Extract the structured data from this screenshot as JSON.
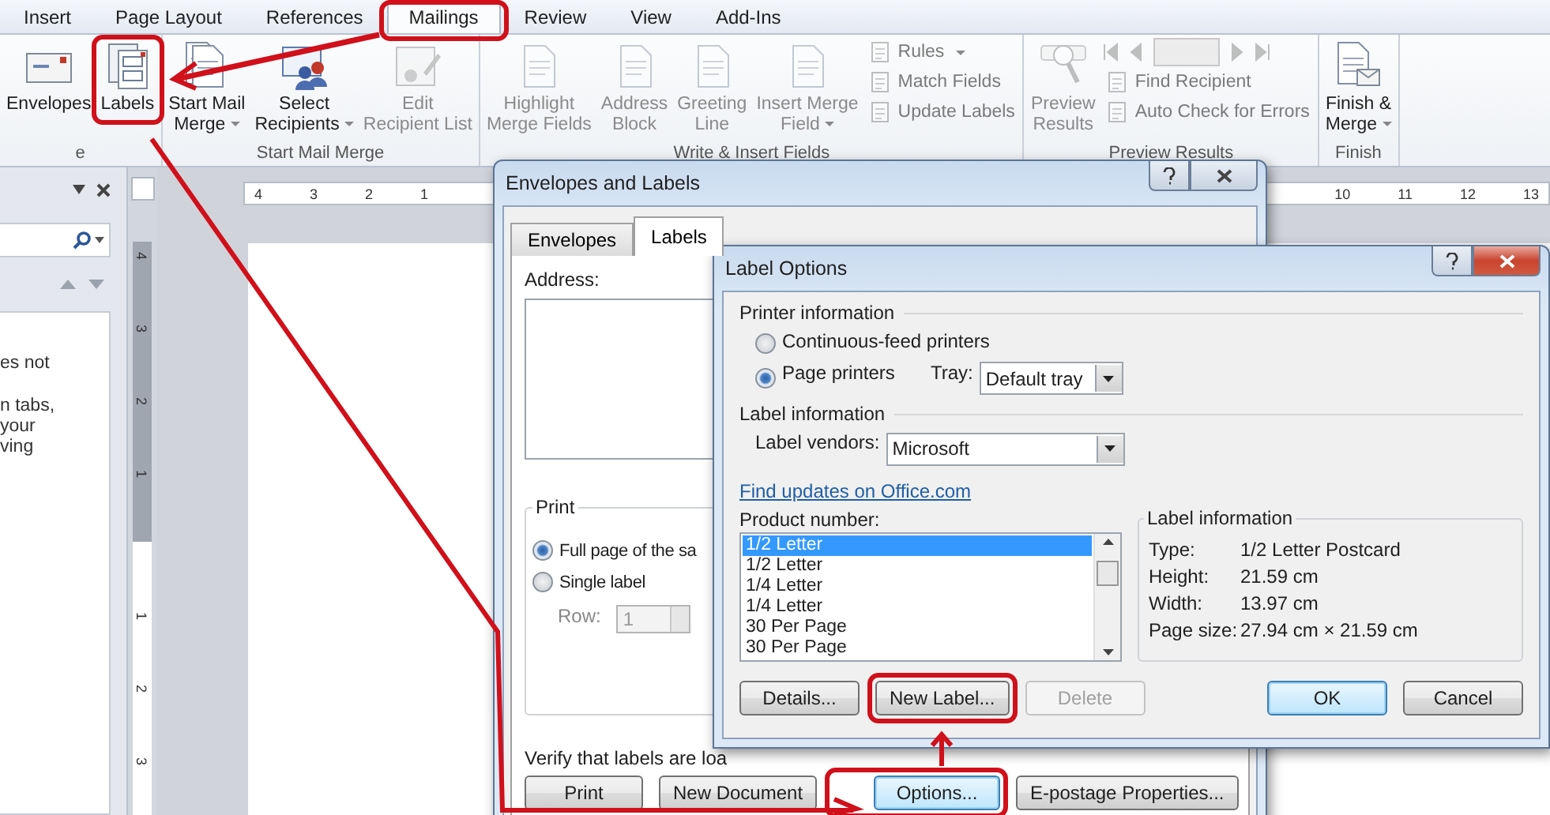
{
  "ribbon_tabs": [
    {
      "label": "Insert",
      "selected": false,
      "annotated": false
    },
    {
      "label": "Page Layout",
      "selected": false,
      "annotated": false
    },
    {
      "label": "References",
      "selected": false,
      "annotated": false
    },
    {
      "label": "Mailings",
      "selected": true,
      "annotated": true
    },
    {
      "label": "Review",
      "selected": false,
      "annotated": false
    },
    {
      "label": "View",
      "selected": false,
      "annotated": false
    },
    {
      "label": "Add-Ins",
      "selected": false,
      "annotated": false
    }
  ],
  "ribbon_groups": [
    {
      "label": "e",
      "large_buttons": [
        {
          "lines": [
            "Envelopes"
          ],
          "dropdown": false,
          "disabled": false,
          "annotated": false
        },
        {
          "lines": [
            "Labels"
          ],
          "dropdown": false,
          "disabled": false,
          "annotated": true
        }
      ]
    },
    {
      "label": "Start Mail Merge",
      "large_buttons": [
        {
          "lines": [
            "Start Mail",
            "Merge"
          ],
          "dropdown": true,
          "disabled": false,
          "annotated": false
        },
        {
          "lines": [
            "Select",
            "Recipients"
          ],
          "dropdown": true,
          "disabled": false,
          "annotated": false
        },
        {
          "lines": [
            "Edit",
            "Recipient List"
          ],
          "dropdown": false,
          "disabled": true,
          "annotated": false
        }
      ]
    },
    {
      "label": "Write & Insert Fields",
      "large_buttons": [
        {
          "lines": [
            "Highlight",
            "Merge Fields"
          ],
          "dropdown": false,
          "disabled": true,
          "annotated": false
        },
        {
          "lines": [
            "Address",
            "Block"
          ],
          "dropdown": false,
          "disabled": true,
          "annotated": false
        },
        {
          "lines": [
            "Greeting",
            "Line"
          ],
          "dropdown": false,
          "disabled": true,
          "annotated": false
        },
        {
          "lines": [
            "Insert Merge",
            "Field"
          ],
          "dropdown": true,
          "disabled": true,
          "annotated": false
        }
      ],
      "small_buttons": [
        {
          "label": "Rules",
          "dropdown": true,
          "disabled": true
        },
        {
          "label": "Match Fields",
          "dropdown": false,
          "disabled": true
        },
        {
          "label": "Update Labels",
          "dropdown": false,
          "disabled": true
        }
      ]
    },
    {
      "label": "Preview Results",
      "large_buttons": [
        {
          "lines": [
            "Preview",
            "Results"
          ],
          "dropdown": false,
          "disabled": true,
          "annotated": false
        }
      ],
      "record_navigator": {
        "disabled": true
      },
      "small_buttons": [
        {
          "label": "Find Recipient",
          "dropdown": false,
          "disabled": true
        },
        {
          "label": "Auto Check for Errors",
          "dropdown": false,
          "disabled": true
        }
      ]
    },
    {
      "label": "Finish",
      "large_buttons": [
        {
          "lines": [
            "Finish &",
            "Merge"
          ],
          "dropdown": true,
          "disabled": false,
          "annotated": false
        }
      ]
    }
  ],
  "nav_pane": {
    "paragraphs": [
      [
        "es not"
      ],
      [
        "n tabs,",
        "your",
        "ving"
      ]
    ]
  },
  "horizontal_ruler": {
    "left_numbers": [
      "4",
      "3",
      "2",
      "1"
    ],
    "right_numbers": [
      "10",
      "11",
      "12",
      "13"
    ]
  },
  "vertical_ruler": [
    "4",
    "3",
    "2",
    "1",
    "1",
    "2",
    "3"
  ],
  "envelopes_dialog": {
    "title": "Envelopes and Labels",
    "tabs": [
      {
        "label": "Envelopes",
        "selected": false
      },
      {
        "label": "Labels",
        "selected": true
      }
    ],
    "address_label": "Address:",
    "print_group": {
      "title": "Print",
      "options": [
        {
          "label": "Full page of the sa",
          "selected": true
        },
        {
          "label": "Single label",
          "selected": false
        }
      ],
      "row_label": "Row:",
      "row_value": "1",
      "row_disabled": true
    },
    "verify_text": "Verify that labels are loa",
    "buttons": [
      {
        "label": "Print",
        "focused": false,
        "annotated": false
      },
      {
        "label": "New Document",
        "focused": false,
        "annotated": false
      },
      {
        "label": "Options...",
        "focused": true,
        "annotated": true
      },
      {
        "label": "E-postage Properties...",
        "focused": false,
        "annotated": false
      }
    ]
  },
  "label_options": {
    "title": "Label Options",
    "printer_information": {
      "title": "Printer information",
      "options": [
        {
          "label": "Continuous-feed printers",
          "selected": false
        },
        {
          "label": "Page printers",
          "selected": true
        }
      ],
      "tray_label": "Tray:",
      "tray_value": "Default tray"
    },
    "label_information": {
      "title": "Label information",
      "vendors_label": "Label vendors:",
      "vendor_value": "Microsoft",
      "link": "Find updates on Office.com"
    },
    "product_number": {
      "label": "Product number:",
      "items": [
        {
          "label": "1/2 Letter",
          "selected": true
        },
        {
          "label": "1/2 Letter",
          "selected": false
        },
        {
          "label": "1/4 Letter",
          "selected": false
        },
        {
          "label": "1/4 Letter",
          "selected": false
        },
        {
          "label": "30 Per Page",
          "selected": false
        },
        {
          "label": "30 Per Page",
          "selected": false
        }
      ]
    },
    "details": {
      "title": "Label information",
      "rows": [
        {
          "name": "Type:",
          "value": "1/2 Letter Postcard"
        },
        {
          "name": "Height:",
          "value": "21.59 cm"
        },
        {
          "name": "Width:",
          "value": "13.97 cm"
        },
        {
          "name": "Page size:",
          "value": "27.94 cm × 21.59 cm"
        }
      ]
    },
    "buttons_left": [
      {
        "label": "Details...",
        "disabled": false,
        "default": false,
        "annotated": false
      },
      {
        "label": "New Label...",
        "disabled": false,
        "default": false,
        "annotated": true
      },
      {
        "label": "Delete",
        "disabled": true,
        "default": false,
        "annotated": false
      }
    ],
    "buttons_right": [
      {
        "label": "OK",
        "disabled": false,
        "default": true,
        "annotated": false
      },
      {
        "label": "Cancel",
        "disabled": false,
        "default": false,
        "annotated": false
      }
    ]
  }
}
